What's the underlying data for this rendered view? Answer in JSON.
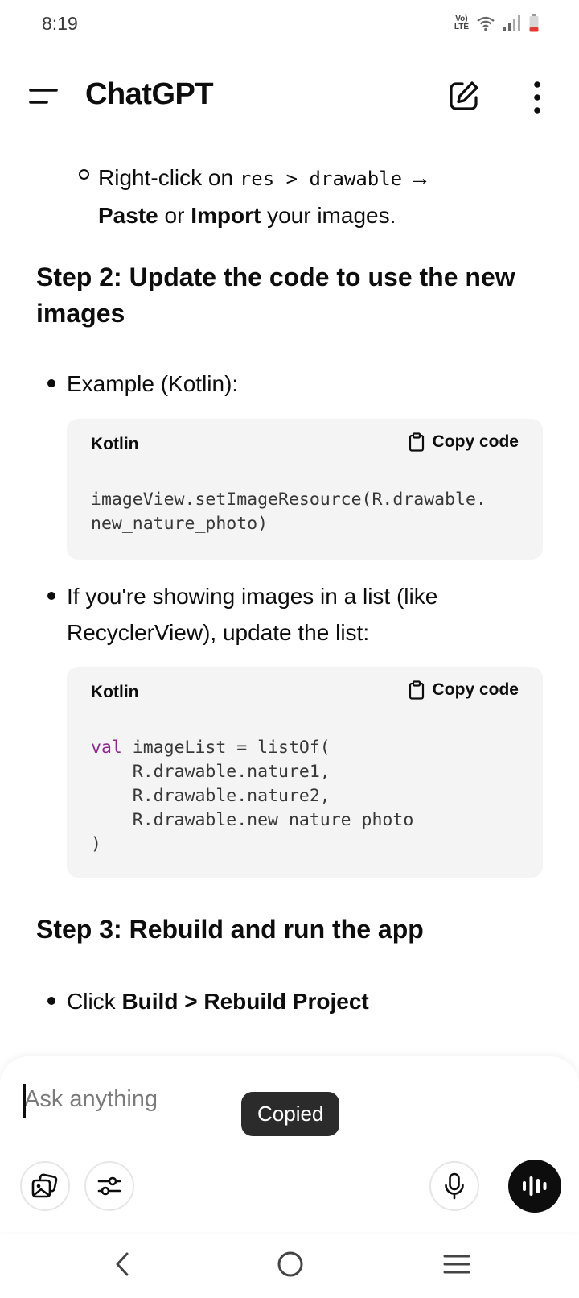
{
  "status_bar": {
    "time": "8:19",
    "volte_line1": "Vo)",
    "volte_line2": "LTE",
    "icons": [
      "volte-icon",
      "wifi-icon",
      "signal-icon",
      "battery-icon"
    ],
    "battery_color": "#e53935"
  },
  "header": {
    "title": "ChatGPT",
    "icons": [
      "menu-icon",
      "new-chat-icon",
      "more-vert-icon"
    ]
  },
  "message": {
    "sub_bullet": {
      "prefix": "Right-click on ",
      "code": "res > drawable",
      "arrow": " →",
      "bold1": "Paste",
      "mid": " or ",
      "bold2": "Import",
      "suffix": " your images."
    },
    "step2_heading": "Step 2: Update the code to use the new images",
    "bullet1": "Example (Kotlin):",
    "code1": {
      "lang": "Kotlin",
      "copy_label": "Copy code",
      "line1": "imageView.setImageResource(R.drawable.",
      "line2": "new_nature_photo)"
    },
    "bullet2": "If you're showing images in a list (like RecyclerView), update the list:",
    "code2": {
      "lang": "Kotlin",
      "copy_label": "Copy code",
      "keyword": "val",
      "line1_rest": " imageList = listOf(",
      "line2": "    R.drawable.nature1,",
      "line3": "    R.drawable.nature2,",
      "line4": "    R.drawable.new_nature_photo",
      "line5": ")"
    },
    "step3_heading": "Step 3: Rebuild and run the app",
    "bullet3": {
      "prefix": "Click ",
      "bold": "Build > Rebuild Project"
    }
  },
  "composer": {
    "placeholder": "Ask anything",
    "value": "",
    "toast": "Copied",
    "icons": [
      "image-icon",
      "tools-icon",
      "mic-icon",
      "voice-mode-icon"
    ]
  },
  "nav_bar": {
    "icons": [
      "back-icon",
      "home-icon",
      "recents-icon"
    ]
  }
}
